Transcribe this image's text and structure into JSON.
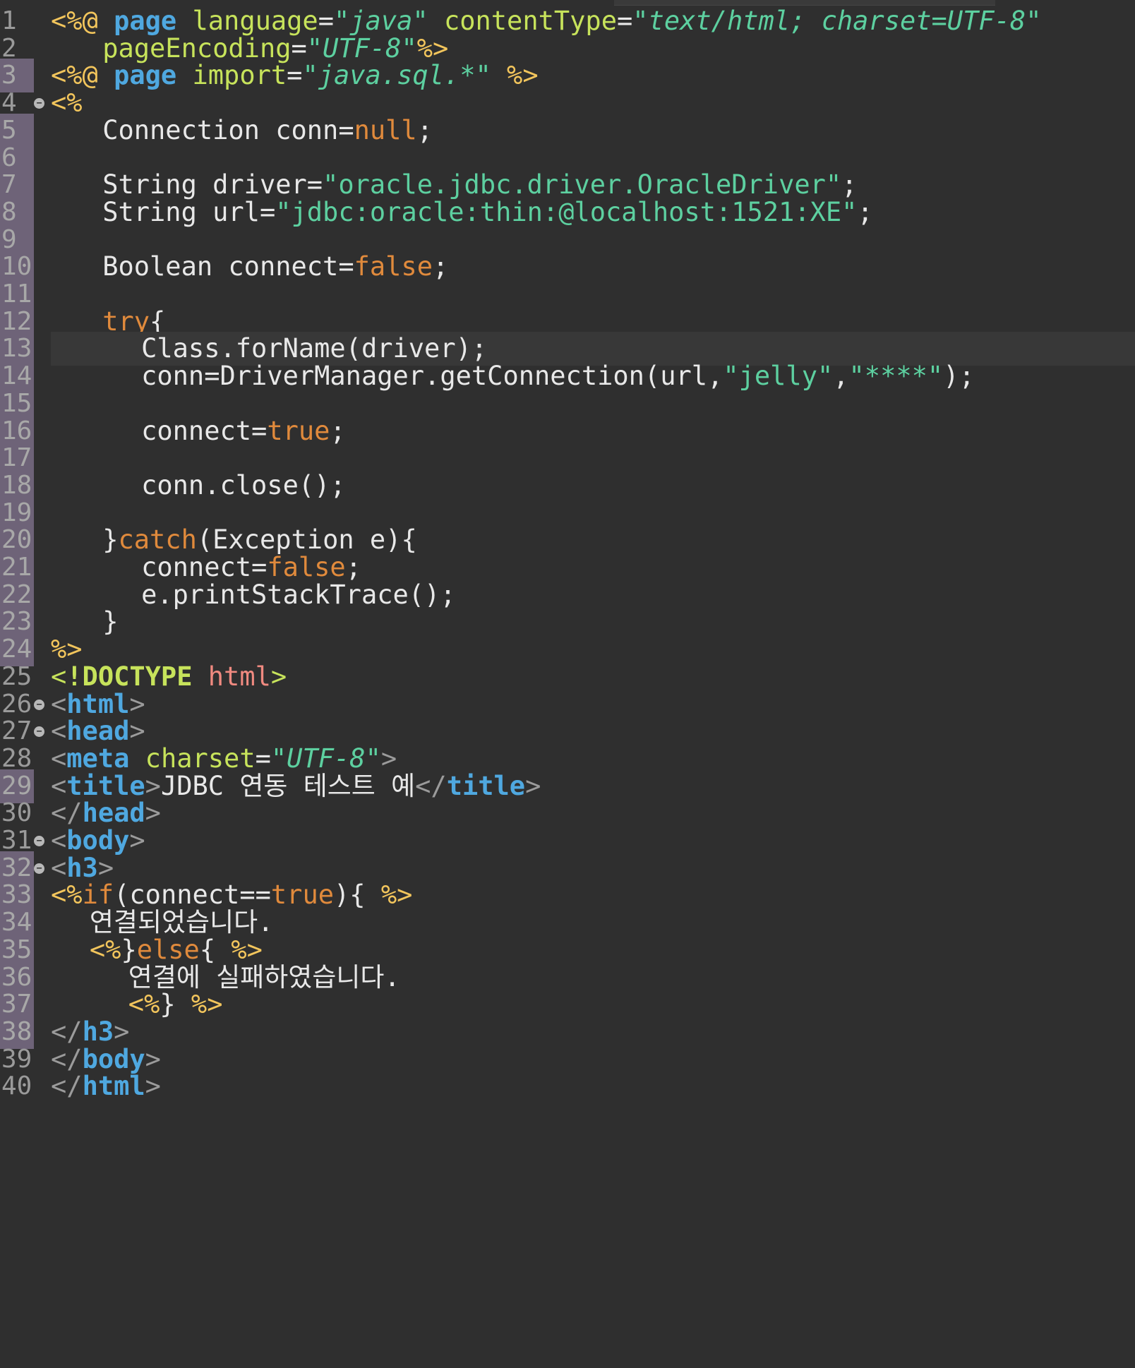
{
  "editor": {
    "lines": [
      {
        "n": "1",
        "mark": false,
        "fold": false,
        "current": false,
        "indent": 0,
        "tokens": [
          [
            "delim",
            "<%@ "
          ],
          [
            "kw",
            "page"
          ],
          [
            "plain",
            " "
          ],
          [
            "attr",
            "language"
          ],
          [
            "plain",
            "="
          ],
          [
            "str",
            "\""
          ],
          [
            "stri",
            "java"
          ],
          [
            "str",
            "\""
          ],
          [
            "plain",
            " "
          ],
          [
            "attr",
            "contentType"
          ],
          [
            "plain",
            "="
          ],
          [
            "str",
            "\""
          ],
          [
            "stri",
            "text/html; charset=UTF-8"
          ],
          [
            "str",
            "\""
          ]
        ]
      },
      {
        "n": "2",
        "mark": false,
        "fold": false,
        "current": false,
        "indent": 4,
        "tokens": [
          [
            "attr",
            "pageEncoding"
          ],
          [
            "plain",
            "="
          ],
          [
            "str",
            "\""
          ],
          [
            "stri",
            "UTF-8"
          ],
          [
            "str",
            "\""
          ],
          [
            "delim",
            "%>"
          ]
        ]
      },
      {
        "n": "3",
        "mark": true,
        "fold": false,
        "current": false,
        "indent": 0,
        "tokens": [
          [
            "delim",
            "<%@ "
          ],
          [
            "kw",
            "page"
          ],
          [
            "plain",
            " "
          ],
          [
            "attr",
            "import"
          ],
          [
            "plain",
            "="
          ],
          [
            "str",
            "\""
          ],
          [
            "stri",
            "java.sql.*"
          ],
          [
            "str",
            "\""
          ],
          [
            "plain",
            " "
          ],
          [
            "delim",
            "%>"
          ]
        ]
      },
      {
        "n": "4",
        "mark": false,
        "fold": true,
        "current": false,
        "indent": 0,
        "tokens": [
          [
            "delim",
            "<%"
          ]
        ]
      },
      {
        "n": "5",
        "mark": true,
        "fold": false,
        "current": false,
        "indent": 4,
        "tokens": [
          [
            "plain",
            "Connection conn="
          ],
          [
            "lit",
            "null"
          ],
          [
            "plain",
            ";"
          ]
        ]
      },
      {
        "n": "6",
        "mark": true,
        "fold": false,
        "current": false,
        "indent": 0,
        "tokens": []
      },
      {
        "n": "7",
        "mark": true,
        "fold": false,
        "current": false,
        "indent": 4,
        "tokens": [
          [
            "plain",
            "String driver="
          ],
          [
            "str",
            "\"oracle.jdbc.driver.OracleDriver\""
          ],
          [
            "plain",
            ";"
          ]
        ]
      },
      {
        "n": "8",
        "mark": true,
        "fold": false,
        "current": false,
        "indent": 4,
        "tokens": [
          [
            "plain",
            "String url="
          ],
          [
            "str",
            "\"jdbc:oracle:thin:@localhost:1521:XE\""
          ],
          [
            "plain",
            ";"
          ]
        ]
      },
      {
        "n": "9",
        "mark": true,
        "fold": false,
        "current": false,
        "indent": 0,
        "tokens": []
      },
      {
        "n": "10",
        "mark": true,
        "fold": false,
        "current": false,
        "indent": 4,
        "tokens": [
          [
            "plain",
            "Boolean connect="
          ],
          [
            "lit",
            "false"
          ],
          [
            "plain",
            ";"
          ]
        ]
      },
      {
        "n": "11",
        "mark": true,
        "fold": false,
        "current": false,
        "indent": 0,
        "tokens": []
      },
      {
        "n": "12",
        "mark": true,
        "fold": false,
        "current": false,
        "indent": 4,
        "tokens": [
          [
            "lit",
            "try"
          ],
          [
            "plain",
            "{"
          ]
        ]
      },
      {
        "n": "13",
        "mark": true,
        "fold": false,
        "current": true,
        "indent": 7,
        "tokens": [
          [
            "plain",
            "Class.forName(driver);"
          ]
        ]
      },
      {
        "n": "14",
        "mark": true,
        "fold": false,
        "current": false,
        "indent": 7,
        "tokens": [
          [
            "plain",
            "conn=DriverManager.getConnection(url,"
          ],
          [
            "str",
            "\"jelly\""
          ],
          [
            "plain",
            ","
          ],
          [
            "str",
            "\"****\""
          ],
          [
            "plain",
            ");"
          ]
        ]
      },
      {
        "n": "15",
        "mark": true,
        "fold": false,
        "current": false,
        "indent": 0,
        "tokens": []
      },
      {
        "n": "16",
        "mark": true,
        "fold": false,
        "current": false,
        "indent": 7,
        "tokens": [
          [
            "plain",
            "connect="
          ],
          [
            "lit",
            "true"
          ],
          [
            "plain",
            ";"
          ]
        ]
      },
      {
        "n": "17",
        "mark": true,
        "fold": false,
        "current": false,
        "indent": 0,
        "tokens": []
      },
      {
        "n": "18",
        "mark": true,
        "fold": false,
        "current": false,
        "indent": 7,
        "tokens": [
          [
            "plain",
            "conn.close();"
          ]
        ]
      },
      {
        "n": "19",
        "mark": true,
        "fold": false,
        "current": false,
        "indent": 0,
        "tokens": []
      },
      {
        "n": "20",
        "mark": true,
        "fold": false,
        "current": false,
        "indent": 4,
        "tokens": [
          [
            "plain",
            "}"
          ],
          [
            "lit",
            "catch"
          ],
          [
            "plain",
            "(Exception e){"
          ]
        ]
      },
      {
        "n": "21",
        "mark": true,
        "fold": false,
        "current": false,
        "indent": 7,
        "tokens": [
          [
            "plain",
            "connect="
          ],
          [
            "lit",
            "false"
          ],
          [
            "plain",
            ";"
          ]
        ]
      },
      {
        "n": "22",
        "mark": true,
        "fold": false,
        "current": false,
        "indent": 7,
        "tokens": [
          [
            "plain",
            "e.printStackTrace();"
          ]
        ]
      },
      {
        "n": "23",
        "mark": true,
        "fold": false,
        "current": false,
        "indent": 4,
        "tokens": [
          [
            "plain",
            "}"
          ]
        ]
      },
      {
        "n": "24",
        "mark": true,
        "fold": false,
        "current": false,
        "indent": 0,
        "tokens": [
          [
            "delim",
            "%>"
          ]
        ]
      },
      {
        "n": "25",
        "mark": false,
        "fold": false,
        "current": false,
        "indent": 0,
        "tokens": [
          [
            "attr",
            "<"
          ],
          [
            "doc",
            "!DOCTYPE"
          ],
          [
            "plain",
            " "
          ],
          [
            "dochtml",
            "html"
          ],
          [
            "attr",
            ">"
          ]
        ]
      },
      {
        "n": "26",
        "mark": false,
        "fold": true,
        "current": false,
        "indent": 0,
        "tokens": [
          [
            "br",
            "<"
          ],
          [
            "tag",
            "html"
          ],
          [
            "br",
            ">"
          ]
        ]
      },
      {
        "n": "27",
        "mark": false,
        "fold": true,
        "current": false,
        "indent": 0,
        "tokens": [
          [
            "br",
            "<"
          ],
          [
            "tag",
            "head"
          ],
          [
            "br",
            ">"
          ]
        ]
      },
      {
        "n": "28",
        "mark": false,
        "fold": false,
        "current": false,
        "indent": 0,
        "tokens": [
          [
            "br",
            "<"
          ],
          [
            "tag",
            "meta"
          ],
          [
            "plain",
            " "
          ],
          [
            "attr",
            "charset"
          ],
          [
            "plain",
            "="
          ],
          [
            "str",
            "\""
          ],
          [
            "stri",
            "UTF-8"
          ],
          [
            "str",
            "\""
          ],
          [
            "br",
            ">"
          ]
        ]
      },
      {
        "n": "29",
        "mark": true,
        "fold": false,
        "current": false,
        "indent": 0,
        "tokens": [
          [
            "br",
            "<"
          ],
          [
            "tag",
            "title"
          ],
          [
            "br",
            ">"
          ],
          [
            "plain",
            "JDBC 연동 테스트 예"
          ],
          [
            "br",
            "</"
          ],
          [
            "tag",
            "title"
          ],
          [
            "br",
            ">"
          ]
        ]
      },
      {
        "n": "30",
        "mark": false,
        "fold": false,
        "current": false,
        "indent": 0,
        "tokens": [
          [
            "br",
            "</"
          ],
          [
            "tag",
            "head"
          ],
          [
            "br",
            ">"
          ]
        ]
      },
      {
        "n": "31",
        "mark": false,
        "fold": true,
        "current": false,
        "indent": 0,
        "tokens": [
          [
            "br",
            "<"
          ],
          [
            "tag",
            "body"
          ],
          [
            "br",
            ">"
          ]
        ]
      },
      {
        "n": "32",
        "mark": true,
        "fold": true,
        "current": false,
        "indent": 0,
        "tokens": [
          [
            "br",
            "<"
          ],
          [
            "tag",
            "h3"
          ],
          [
            "br",
            ">"
          ]
        ]
      },
      {
        "n": "33",
        "mark": true,
        "fold": false,
        "current": false,
        "indent": 0,
        "tokens": [
          [
            "delim",
            "<%"
          ],
          [
            "lit",
            "if"
          ],
          [
            "plain",
            "(connect=="
          ],
          [
            "lit",
            "true"
          ],
          [
            "plain",
            "){ "
          ],
          [
            "delim",
            "%>"
          ]
        ]
      },
      {
        "n": "34",
        "mark": true,
        "fold": false,
        "current": false,
        "indent": 3,
        "tokens": [
          [
            "plain",
            "연결되었습니다."
          ]
        ]
      },
      {
        "n": "35",
        "mark": true,
        "fold": false,
        "current": false,
        "indent": 3,
        "tokens": [
          [
            "delim",
            "<%"
          ],
          [
            "plain",
            "}"
          ],
          [
            "lit",
            "else"
          ],
          [
            "plain",
            "{ "
          ],
          [
            "delim",
            "%>"
          ]
        ]
      },
      {
        "n": "36",
        "mark": true,
        "fold": false,
        "current": false,
        "indent": 6,
        "tokens": [
          [
            "plain",
            "연결에 실패하였습니다."
          ]
        ]
      },
      {
        "n": "37",
        "mark": true,
        "fold": false,
        "current": false,
        "indent": 6,
        "tokens": [
          [
            "delim",
            "<%"
          ],
          [
            "plain",
            "} "
          ],
          [
            "delim",
            "%>"
          ]
        ]
      },
      {
        "n": "38",
        "mark": true,
        "fold": false,
        "current": false,
        "indent": 0,
        "tokens": [
          [
            "br",
            "</"
          ],
          [
            "tag",
            "h3"
          ],
          [
            "br",
            ">"
          ]
        ]
      },
      {
        "n": "39",
        "mark": false,
        "fold": false,
        "current": false,
        "indent": 0,
        "tokens": [
          [
            "br",
            "</"
          ],
          [
            "tag",
            "body"
          ],
          [
            "br",
            ">"
          ]
        ]
      },
      {
        "n": "40",
        "mark": false,
        "fold": false,
        "current": false,
        "indent": 0,
        "tokens": [
          [
            "br",
            "</"
          ],
          [
            "tag",
            "html"
          ],
          [
            "br",
            ">"
          ]
        ]
      }
    ]
  }
}
